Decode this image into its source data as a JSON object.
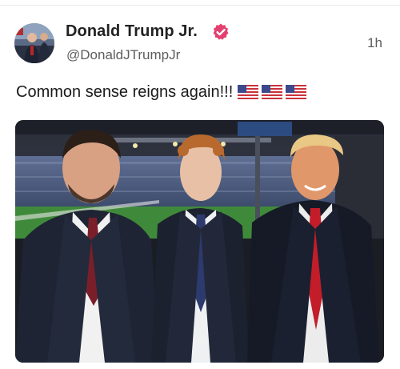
{
  "post": {
    "author": {
      "display_name": "Donald Trump Jr.",
      "handle": "@DonaldJTrumpJr",
      "verified_icon": "verified-badge-icon",
      "avatar_icon": "profile-avatar"
    },
    "timestamp": "1h",
    "text": "Common sense reigns again!!!",
    "emoji": [
      "us-flag-icon",
      "us-flag-icon",
      "us-flag-icon"
    ],
    "media": {
      "type": "photo",
      "subject": "three men in suits posing in a stadium suite"
    }
  },
  "colors": {
    "verified_badge": "#e4406f",
    "handle_text": "#5d5d5d",
    "name_text": "#222222"
  }
}
